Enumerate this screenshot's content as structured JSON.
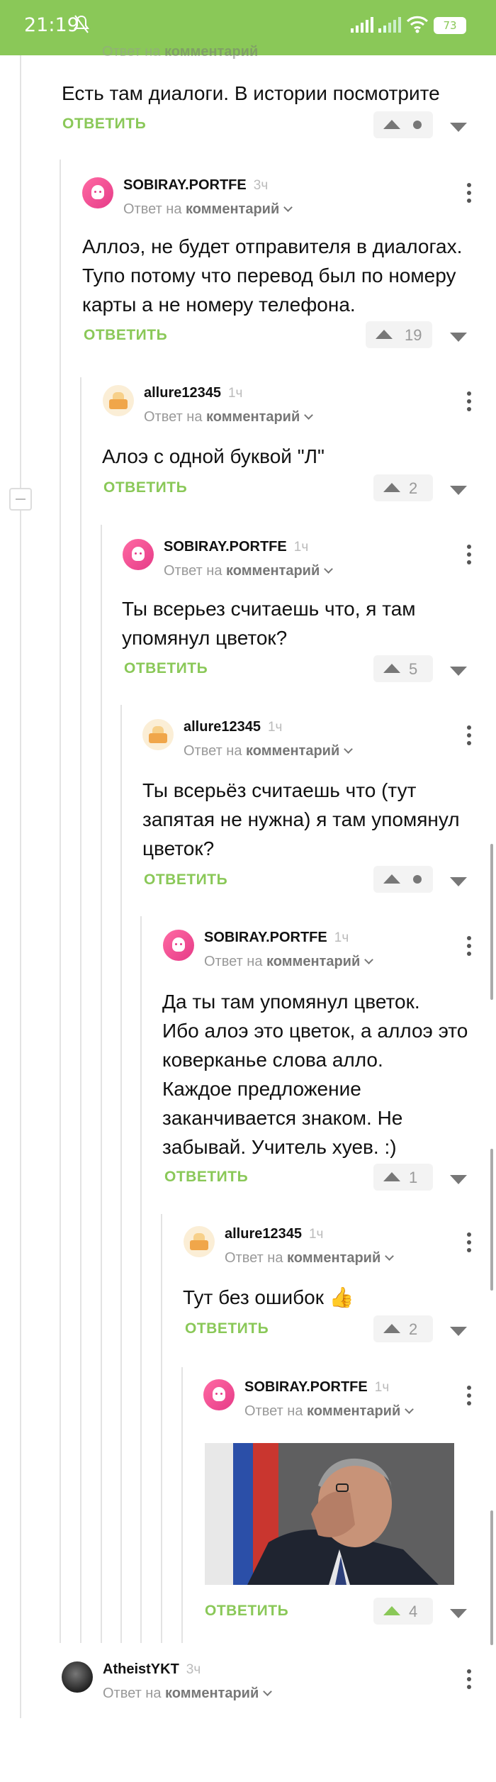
{
  "status_bar": {
    "time": "21:19",
    "battery": "73"
  },
  "partial_header": {
    "reply_to_prefix": "Ответ на",
    "reply_to_target": "комментарий"
  },
  "comments": [
    {
      "id": "c0",
      "author": "",
      "time": "",
      "body": [
        "Есть там диалоги. В истории посмотрите"
      ],
      "reply": "ОТВЕТИТЬ",
      "rating": "",
      "avatar": ""
    },
    {
      "id": "c1",
      "author": "SOBIRAY.PORTFE",
      "time": "3ч",
      "reply_to_prefix": "Ответ на",
      "reply_to_target": "комментарий",
      "body": [
        "Аллоэ, не будет отправителя в диалогах.",
        "Тупо потому что перевод был по номеру",
        "карты а не номеру телефона."
      ],
      "reply": "ОТВЕТИТЬ",
      "rating": "19",
      "avatar": "pink"
    },
    {
      "id": "c2",
      "author": "allure12345",
      "time": "1ч",
      "reply_to_prefix": "Ответ на",
      "reply_to_target": "комментарий",
      "body": [
        "Алоэ с одной буквой \"Л\""
      ],
      "reply": "ОТВЕТИТЬ",
      "rating": "2",
      "avatar": "cake"
    },
    {
      "id": "c3",
      "author": "SOBIRAY.PORTFE",
      "time": "1ч",
      "reply_to_prefix": "Ответ на",
      "reply_to_target": "комментарий",
      "body": [
        "Ты всерьез считаешь что, я там",
        "упомянул цветок?"
      ],
      "reply": "ОТВЕТИТЬ",
      "rating": "5",
      "avatar": "pink"
    },
    {
      "id": "c4",
      "author": "allure12345",
      "time": "1ч",
      "reply_to_prefix": "Ответ на",
      "reply_to_target": "комментарий",
      "body": [
        "Ты всерьёз считаешь что (тут",
        "запятая не нужна) я там упомянул",
        "цветок?"
      ],
      "reply": "ОТВЕТИТЬ",
      "rating": "",
      "avatar": "cake"
    },
    {
      "id": "c5",
      "author": "SOBIRAY.PORTFE",
      "time": "1ч",
      "reply_to_prefix": "Ответ на",
      "reply_to_target": "комментарий",
      "body": [
        "Да ты там упомянул цветок.",
        "Ибо алоэ это цветок, а аллоэ это",
        "коверканье слова алло.",
        "Каждое предложение",
        "заканчивается знаком. Не",
        "забывай. Учитель хуев. :)"
      ],
      "reply": "ОТВЕТИТЬ",
      "rating": "1",
      "avatar": "pink"
    },
    {
      "id": "c6",
      "author": "allure12345",
      "time": "1ч",
      "reply_to_prefix": "Ответ на",
      "reply_to_target": "комментарий",
      "body": [
        "Тут без ошибок 👍"
      ],
      "reply": "ОТВЕТИТЬ",
      "rating": "2",
      "avatar": "cake"
    },
    {
      "id": "c7",
      "author": "SOBIRAY.PORTFE",
      "time": "1ч",
      "reply_to_prefix": "Ответ на",
      "reply_to_target": "комментарий",
      "body": [],
      "reply": "ОТВЕТИТЬ",
      "rating": "4",
      "avatar": "pink"
    },
    {
      "id": "c8",
      "author": "AtheistYKT",
      "time": "3ч",
      "reply_to_prefix": "Ответ на",
      "reply_to_target": "комментарий",
      "body": [],
      "reply": "",
      "rating": "",
      "avatar": "dark"
    }
  ],
  "colors": {
    "accent": "#8ac858",
    "upvoted": "#8ac858"
  }
}
